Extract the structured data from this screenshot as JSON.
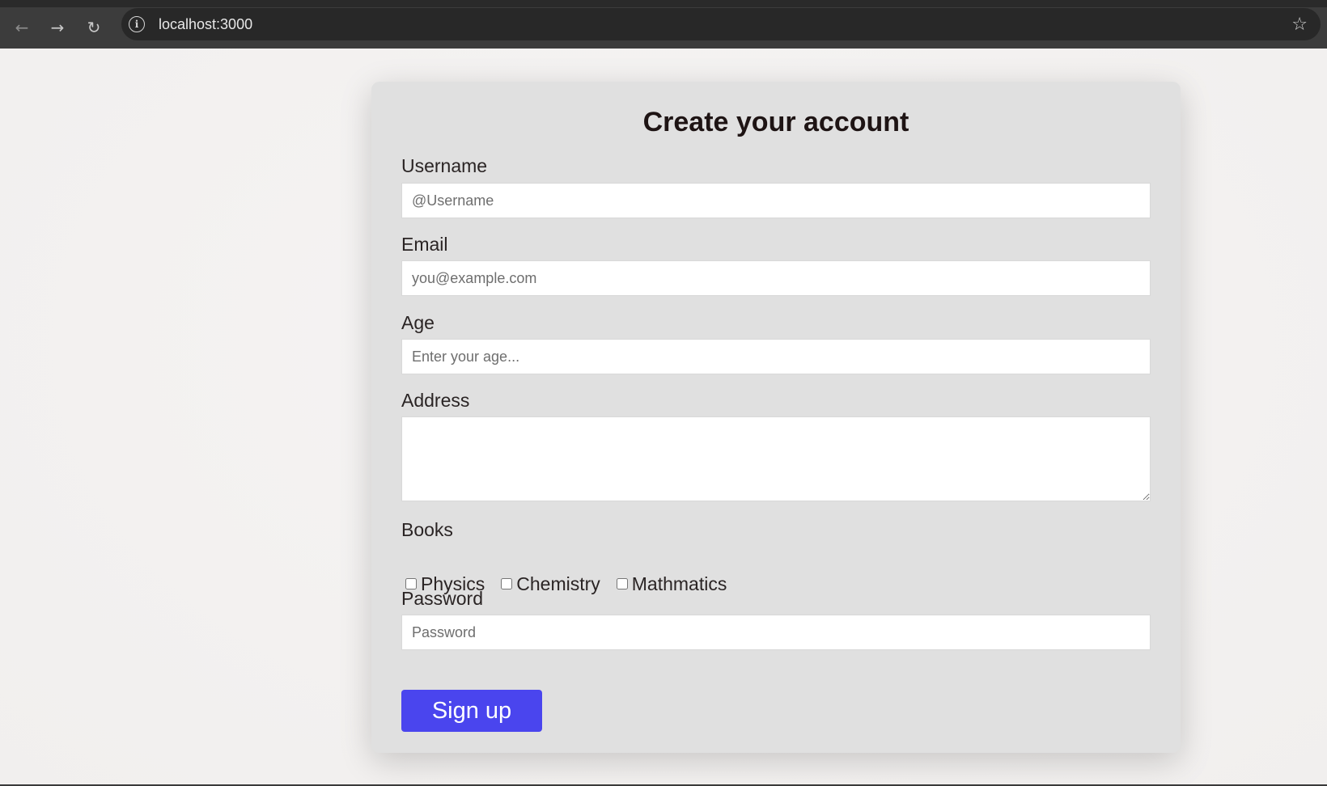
{
  "browser": {
    "url": "localhost:3000",
    "icons": {
      "back": "arrow-left-icon",
      "forward": "arrow-right-icon",
      "reload": "reload-icon",
      "info": "info-icon",
      "bookmark": "star-icon"
    }
  },
  "form": {
    "title": "Create your account",
    "username": {
      "label": "Username",
      "placeholder": "@Username",
      "value": ""
    },
    "email": {
      "label": "Email",
      "placeholder": "you@example.com",
      "value": ""
    },
    "age": {
      "label": "Age",
      "placeholder": "Enter your age...",
      "value": ""
    },
    "address": {
      "label": "Address",
      "value": ""
    },
    "books": {
      "label": "Books",
      "options": [
        {
          "label": "Physics",
          "checked": false
        },
        {
          "label": "Chemistry",
          "checked": false
        },
        {
          "label": "Mathmatics",
          "checked": false
        }
      ]
    },
    "password": {
      "label": "Password",
      "placeholder": "Password",
      "value": ""
    },
    "submit_label": "Sign up"
  },
  "colors": {
    "button": "#4a45ee",
    "card": "#e0e0e0",
    "page": "#f3f1f0"
  }
}
